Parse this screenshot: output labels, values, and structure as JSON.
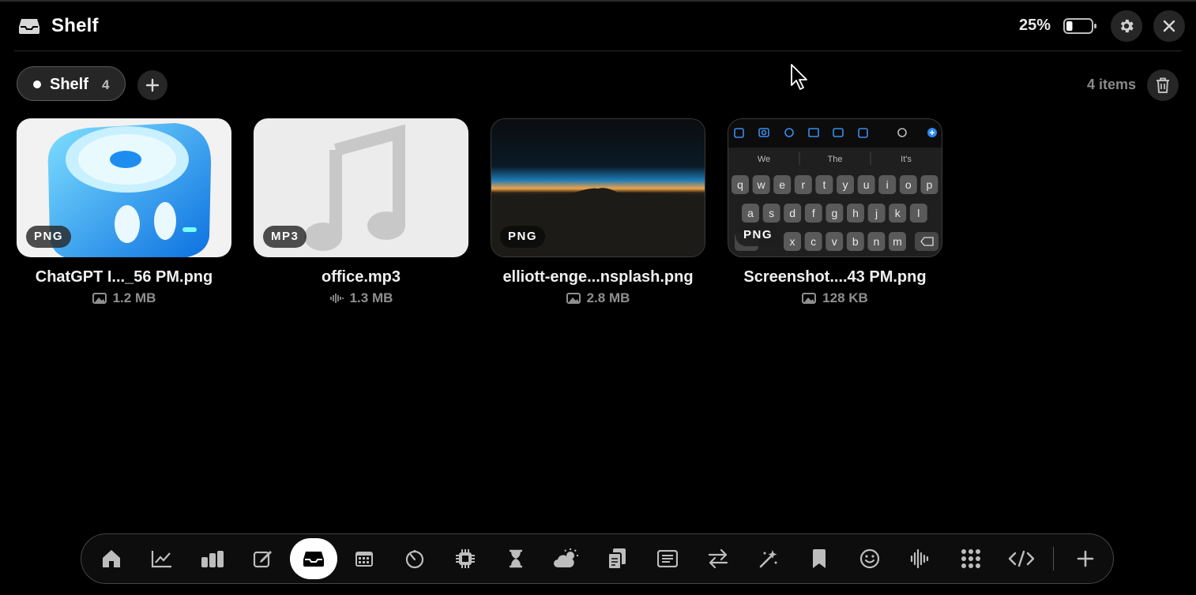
{
  "app": {
    "title": "Shelf",
    "icon": "tray-icon"
  },
  "status": {
    "battery_percent_label": "25%",
    "battery_level": 0.25
  },
  "toolbar": {
    "settings_icon": "gear-icon",
    "close_icon": "close-icon"
  },
  "shelf_tab": {
    "label": "Shelf",
    "count": "4"
  },
  "summary": {
    "items_label": "4 items"
  },
  "files": [
    {
      "name": "ChatGPT I..._56 PM.png",
      "badge": "PNG",
      "size": "1.2 MB",
      "meta_icon": "image-icon"
    },
    {
      "name": "office.mp3",
      "badge": "MP3",
      "size": "1.3 MB",
      "meta_icon": "waveform-icon"
    },
    {
      "name": "elliott-enge...nsplash.png",
      "badge": "PNG",
      "size": "2.8 MB",
      "meta_icon": "image-icon"
    },
    {
      "name": "Screenshot....43 PM.png",
      "badge": "PNG",
      "size": "128 KB",
      "meta_icon": "image-icon"
    }
  ],
  "keyboard_preview": {
    "suggestions": [
      "We",
      "The",
      "It's"
    ],
    "row1": [
      "q",
      "w",
      "e",
      "r",
      "t",
      "y",
      "u",
      "i",
      "o",
      "p"
    ],
    "row2": [
      "a",
      "s",
      "d",
      "f",
      "g",
      "h",
      "j",
      "k",
      "l"
    ],
    "row3": [
      "x",
      "c",
      "v",
      "b",
      "n",
      "m"
    ]
  },
  "dock": {
    "items": [
      "home-icon",
      "chart-line-icon",
      "bar-chart-icon",
      "note-edit-icon",
      "tray-icon",
      "calendar-icon",
      "timer-icon",
      "cpu-icon",
      "hourglass-icon",
      "weather-icon",
      "clipboard-icon",
      "text-box-icon",
      "transfer-icon",
      "magic-wand-icon",
      "bookmark-icon",
      "smiley-icon",
      "audio-wave-icon",
      "grid-icon",
      "code-icon",
      "plus-icon"
    ],
    "active": "tray-icon"
  },
  "colors": {
    "background": "#000000",
    "card_bg": "#262626",
    "accent_white": "#ffffff",
    "muted": "#8f8f8f"
  }
}
